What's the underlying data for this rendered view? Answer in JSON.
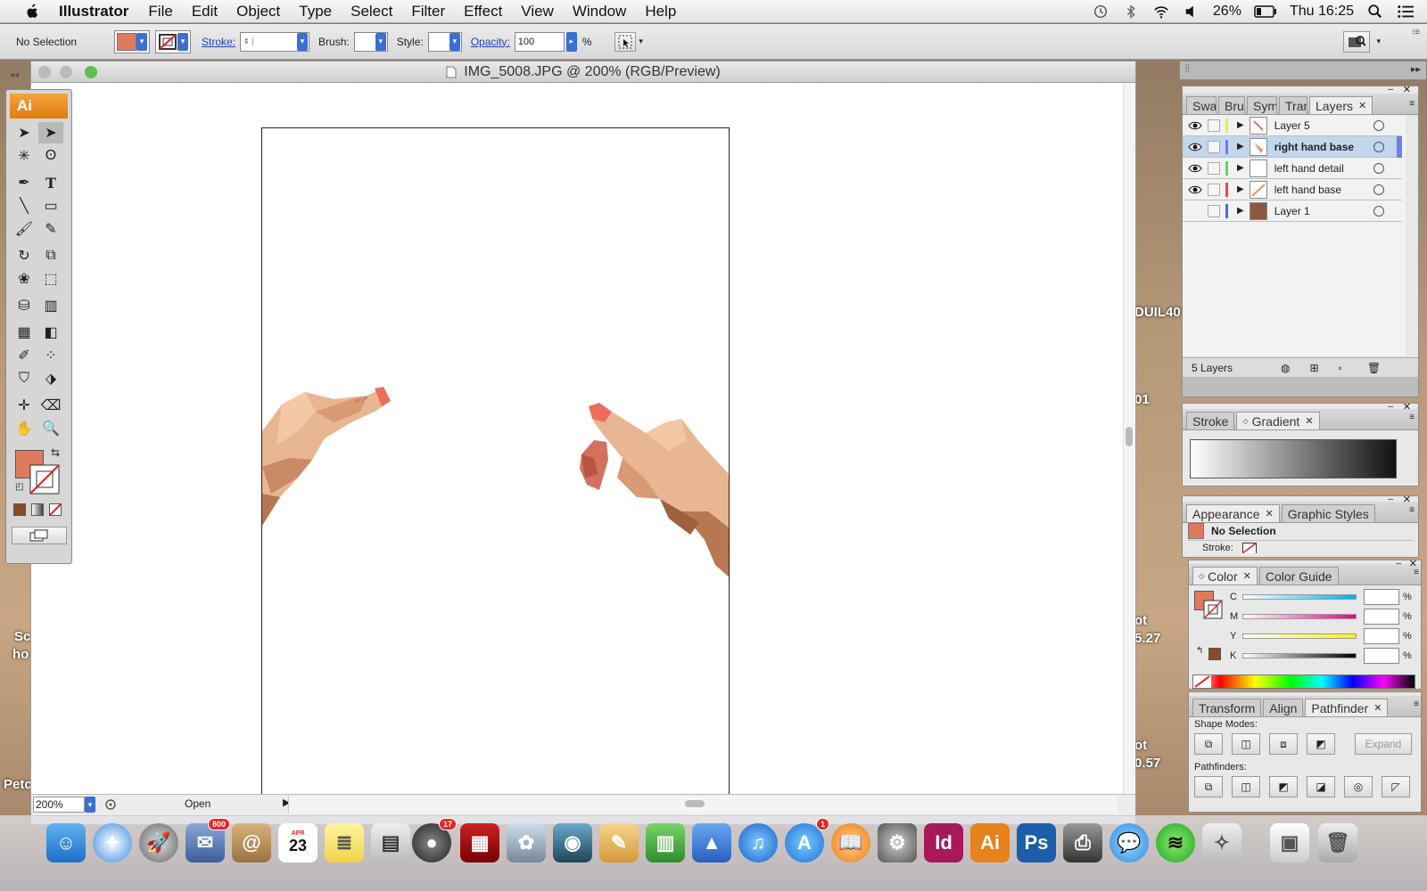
{
  "menubar": {
    "app": "Illustrator",
    "items": [
      "File",
      "Edit",
      "Object",
      "Type",
      "Select",
      "Filter",
      "Effect",
      "View",
      "Window",
      "Help"
    ],
    "battery": "26%",
    "clock": "Thu 16:25"
  },
  "control_bar": {
    "selection_label": "No Selection",
    "stroke_label": "Stroke:",
    "brush_label": "Brush:",
    "style_label": "Style:",
    "opacity_label": "Opacity:",
    "opacity_value": "100",
    "percent": "%",
    "fill_color": "#e07a5f"
  },
  "document": {
    "title": "IMG_5008.JPG @ 200% (RGB/Preview)",
    "zoom": "200%",
    "status": "Open"
  },
  "toolbox": {
    "logo": "Ai",
    "fill_color": "#e07a5f"
  },
  "layers_panel": {
    "tabs": [
      "Swat",
      "Brus",
      "Sym",
      "Tran",
      "Layers"
    ],
    "layers": [
      {
        "name": "Layer 5",
        "color": "#f2e84a",
        "visible": true
      },
      {
        "name": "right hand base",
        "color": "#6f7df0",
        "visible": true
      },
      {
        "name": "left hand detail",
        "color": "#5fd46a",
        "visible": true
      },
      {
        "name": "left hand base",
        "color": "#e84a4a",
        "visible": true
      },
      {
        "name": "Layer 1",
        "color": "#4a6af0",
        "visible": false
      }
    ],
    "count": "5 Layers"
  },
  "gradient_panel": {
    "tabs": [
      "Stroke",
      "Gradient"
    ]
  },
  "appearance_panel": {
    "tabs": [
      "Appearance",
      "Graphic Styles"
    ],
    "selection": "No Selection",
    "stroke_row": "Stroke:"
  },
  "color_panel": {
    "tabs": [
      "Color",
      "Color Guide"
    ],
    "channels": [
      "C",
      "M",
      "Y",
      "K"
    ],
    "percent": "%"
  },
  "pathfinder_panel": {
    "tabs": [
      "Transform",
      "Align",
      "Pathfinder"
    ],
    "shape_modes": "Shape Modes:",
    "expand": "Expand",
    "pathfinders": "Pathfinders:"
  },
  "desktop": {
    "label_1": "DUIL40",
    "label_2": "01",
    "label_3": "ot",
    "label_4": "5.27",
    "label_5": "ot",
    "label_6": "0.57",
    "label_7": "Sc",
    "label_8": "ho",
    "label_9": "Petc"
  },
  "dock": {
    "mail_badge": "800",
    "facetime_badge": "17",
    "appstore_badge": "1",
    "calendar_day": "23",
    "calendar_month": "APR",
    "id_label": "Id",
    "ai_label": "Ai",
    "ps_label": "Ps"
  }
}
